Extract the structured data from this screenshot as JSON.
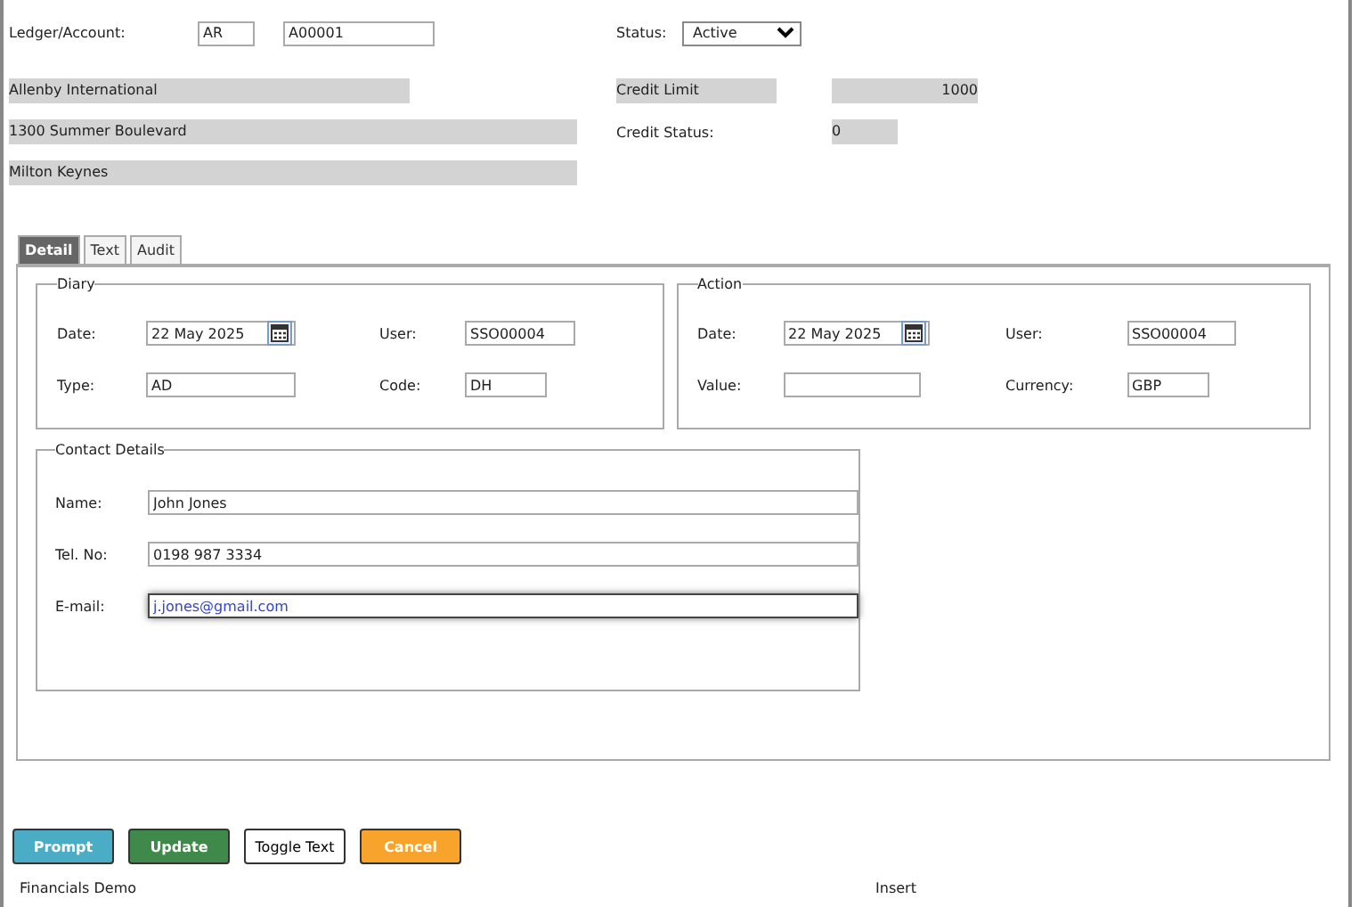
{
  "header": {
    "ledger_label": "Ledger/Account:",
    "ledger": "AR",
    "account": "A00001",
    "status_label": "Status:",
    "status": "Active"
  },
  "address": [
    "Allenby International",
    "1300 Summer Boulevard",
    "Milton Keynes"
  ],
  "credit": {
    "limit_label": "Credit Limit",
    "limit": "1000",
    "status_label": "Credit Status:",
    "status": "0"
  },
  "tabs": [
    {
      "label": "Detail",
      "selected": true
    },
    {
      "label": "Text",
      "selected": false
    },
    {
      "label": "Audit",
      "selected": false
    }
  ],
  "groups": [
    {
      "legend": "Diary",
      "fields": [
        {
          "label": "Date:",
          "value": "22 May 2025",
          "kind": "date"
        },
        {
          "label": "User:",
          "value": "SSO00004",
          "kind": "text"
        },
        {
          "label": "Type:",
          "value": "AD",
          "kind": "text"
        },
        {
          "label": "Code:",
          "value": "DH",
          "kind": "text"
        }
      ]
    },
    {
      "legend": "Action",
      "fields": [
        {
          "label": "Date:",
          "value": "22 May 2025",
          "kind": "date"
        },
        {
          "label": "User:",
          "value": "SSO00004",
          "kind": "text"
        },
        {
          "label": "Value:",
          "kind": "text"
        },
        {
          "label": "Currency:",
          "value": "GBP",
          "kind": "text"
        }
      ]
    }
  ],
  "contact": {
    "legend": "Contact Details",
    "fields": [
      {
        "label": "Name:",
        "value": "John Jones",
        "focused": false
      },
      {
        "label": "Tel. No:",
        "value": "0198 987 3334",
        "focused": false
      },
      {
        "label": "E-mail:",
        "value": "j.jones@gmail.com",
        "focused": true
      }
    ]
  },
  "buttons": [
    {
      "label": "Prompt",
      "color": "#4bacc6"
    },
    {
      "label": "Update",
      "color": "#3f8a4a"
    },
    {
      "label": "Toggle Text",
      "color": "#ffffff"
    },
    {
      "label": "Cancel",
      "color": "#f8a42c"
    }
  ],
  "status_bar": {
    "left": "Financials Demo",
    "right": "Insert"
  }
}
